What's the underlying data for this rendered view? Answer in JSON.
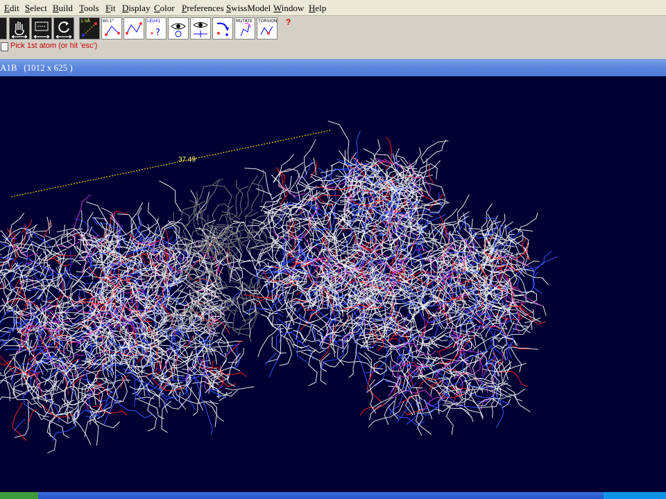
{
  "menu": [
    {
      "label": "Edit",
      "ul": "E",
      "rest": "dit"
    },
    {
      "label": "Select",
      "ul": "S",
      "rest": "elect"
    },
    {
      "label": "Build",
      "ul": "B",
      "rest": "uild"
    },
    {
      "label": "Tools",
      "ul": "T",
      "rest": "ools"
    },
    {
      "label": "Fit",
      "ul": "F",
      "rest": "it"
    },
    {
      "label": "Display",
      "ul": "D",
      "rest": "isplay"
    },
    {
      "label": "Color",
      "ul": "C",
      "rest": "olor"
    },
    {
      "label": "Preferences",
      "ul": "P",
      "rest": "references"
    },
    {
      "label": "SwissModel",
      "ul": "S",
      "rest": "wissModel"
    },
    {
      "label": "Window",
      "ul": "W",
      "rest": "indow"
    },
    {
      "label": "Help",
      "ul": "H",
      "rest": "elp"
    }
  ],
  "toolbar": {
    "buttons": [
      {
        "name": "partial-tool-button",
        "label": "",
        "icon": "partial-icon"
      },
      {
        "name": "translate-button",
        "label": "",
        "icon": "hand-icon"
      },
      {
        "name": "zoom-button",
        "label": "",
        "icon": "zoom-icon"
      },
      {
        "name": "rotate-button",
        "label": "",
        "icon": "rotate-icon"
      },
      {
        "name": "distance-button",
        "label": "1.5Å",
        "icon": "distance-icon"
      },
      {
        "name": "angle-button",
        "label": "60.1°",
        "icon": "angle-icon"
      },
      {
        "name": "torsion-measure-button",
        "label": "",
        "icon": "dihedral-icon"
      },
      {
        "name": "label-button",
        "label": "LEU41",
        "icon": "label-icon"
      },
      {
        "name": "center-button",
        "label": "",
        "icon": "eye-icon"
      },
      {
        "name": "center-atom-button",
        "label": "",
        "icon": "eye-target-icon"
      },
      {
        "name": "superpose-button",
        "label": "",
        "icon": "superpose-icon"
      },
      {
        "name": "mutate-button",
        "label": "MUTATE",
        "icon": "mutate-icon"
      },
      {
        "name": "torsion-button",
        "label": "TORSION",
        "icon": "torsion-icon"
      },
      {
        "name": "help-button",
        "label": "?",
        "icon": "question-icon"
      }
    ]
  },
  "status": {
    "text": "Pick 1st atom (or hit 'esc')"
  },
  "viewer": {
    "title": "A1B   (1012 x 625 )",
    "measurement": {
      "value": "37.49"
    },
    "colors": {
      "background": "#000033",
      "carbon": "#e8e8e8",
      "nitrogen": "#3355ff",
      "oxygen": "#ee2222",
      "highlight": "#cc33cc",
      "grey": "#777777",
      "distance": "#ffcc00"
    }
  }
}
